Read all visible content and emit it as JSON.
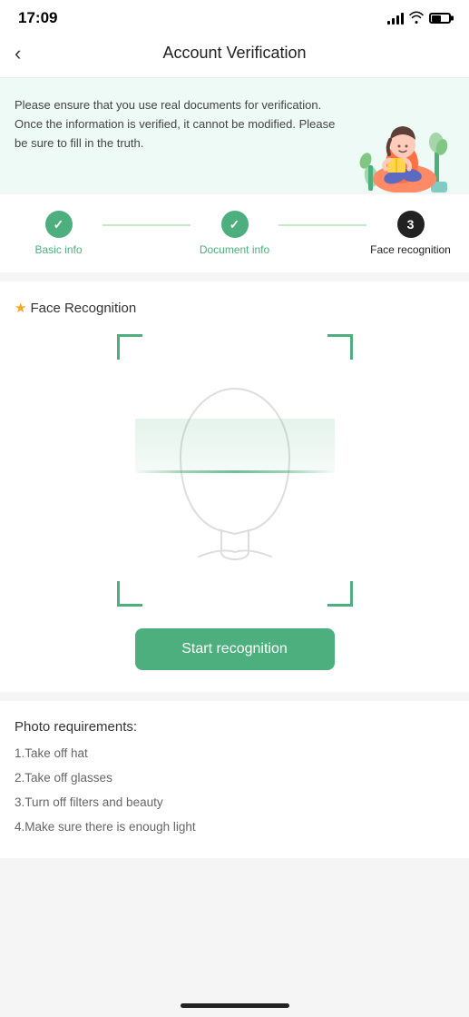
{
  "statusBar": {
    "time": "17:09"
  },
  "header": {
    "title": "Account Verification",
    "backLabel": "<"
  },
  "banner": {
    "text": "Please ensure that you use real documents for verification. Once the information is verified, it cannot be modified. Please be sure to fill in the truth."
  },
  "stepper": {
    "steps": [
      {
        "id": 1,
        "label": "Basic info",
        "state": "done"
      },
      {
        "id": 2,
        "label": "Document info",
        "state": "done"
      },
      {
        "id": 3,
        "label": "Face recognition",
        "state": "active"
      }
    ]
  },
  "faceCard": {
    "asterisk": "★",
    "title": "Face Recognition",
    "startBtn": "Start recognition"
  },
  "requirements": {
    "title": "Photo requirements:",
    "items": [
      "1.Take off hat",
      "2.Take off glasses",
      "3.Turn off filters and beauty",
      "4.Make sure there is enough light"
    ]
  },
  "colors": {
    "green": "#4caf7d",
    "dark": "#222222",
    "orange": "#f5a623"
  }
}
